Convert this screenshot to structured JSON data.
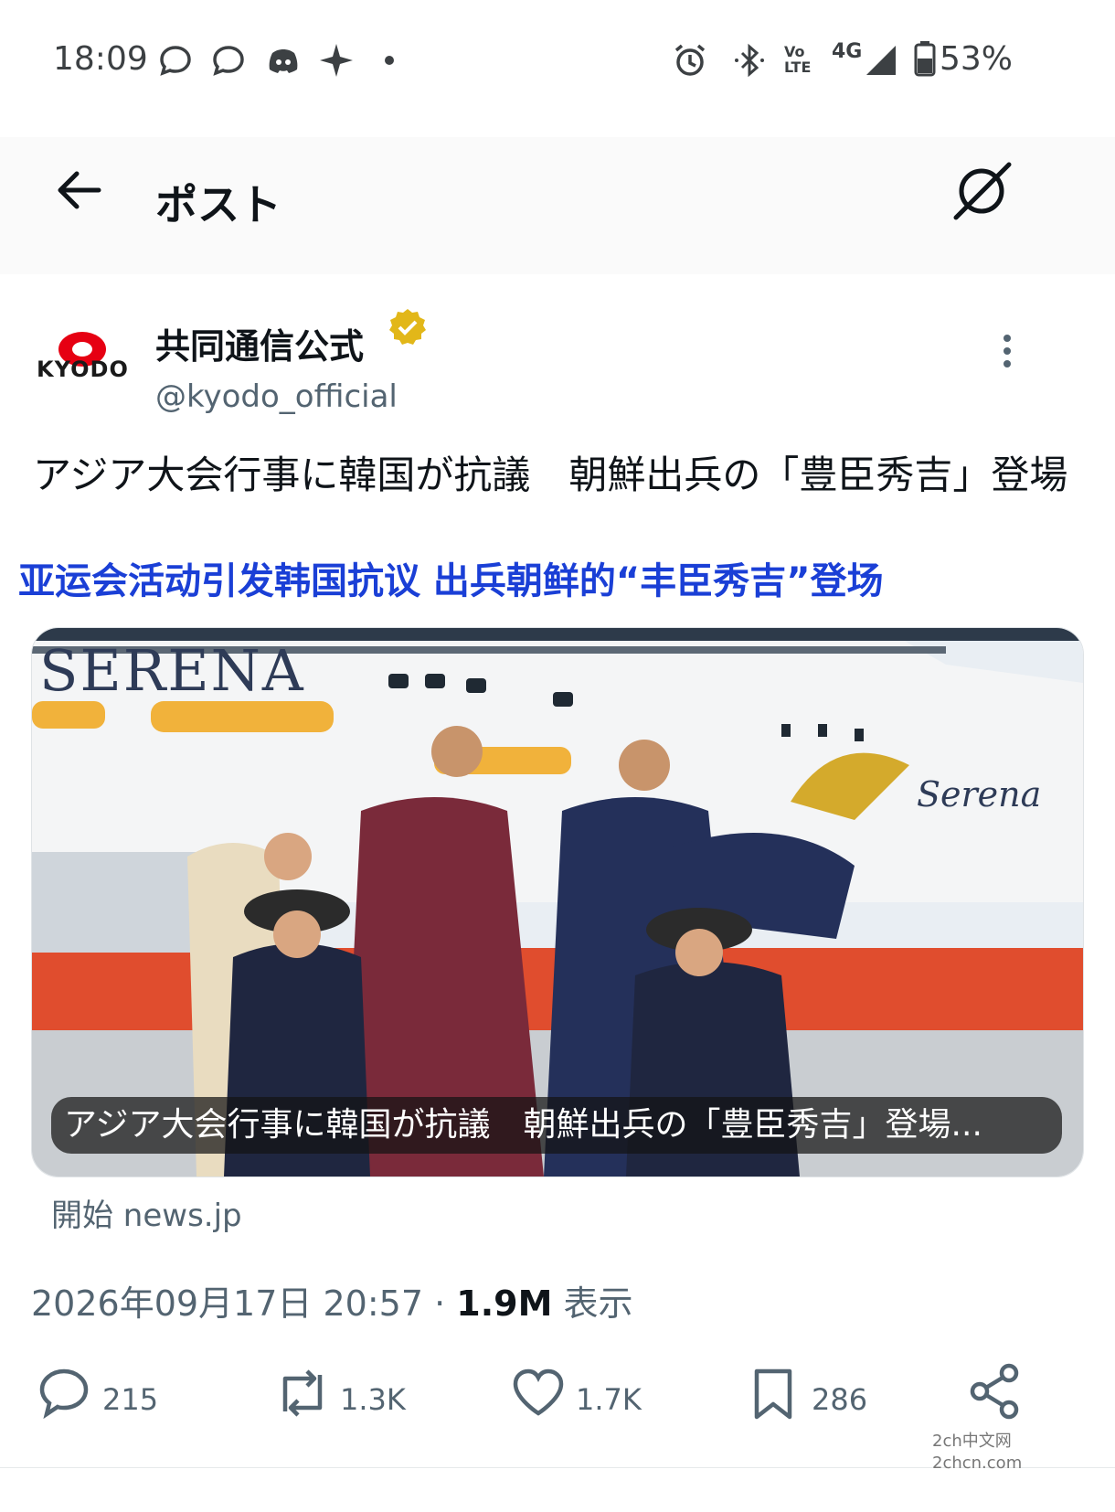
{
  "status_bar": {
    "time": "18:09",
    "battery": "53%",
    "network": "4G",
    "volte": "VoLTE",
    "icons": [
      "chat-bubble-icon",
      "chat-bubble-icon",
      "discord-icon",
      "sparkle-icon",
      "dot-icon",
      "alarm-icon",
      "bluetooth-icon",
      "volte-icon",
      "signal-icon",
      "battery-icon"
    ]
  },
  "header": {
    "title": "ポスト",
    "back_icon": "arrow-left-icon",
    "grok_icon": "slash-circle-icon"
  },
  "account": {
    "avatar_label": "KYODO",
    "name": "共同通信公式",
    "handle": "@kyodo_official",
    "verified_color": "#e2b719"
  },
  "tweet": {
    "text": "アジア大会行事に韓国が抗議　朝鮮出兵の「豊臣秀吉」登場",
    "overlay_translation": "亚运会活动引发韩国抗议 出兵朝鲜的“丰臣秀吉”登场"
  },
  "card": {
    "ship_name": "SERENA",
    "ship_logo": "Serena",
    "caption": "アジア大会行事に韓国が抗議　朝鮮出兵の「豊臣秀吉」登場...",
    "source": "開始 news.jp"
  },
  "meta": {
    "datetime": "2026年09月17日 20:57",
    "separator": "·",
    "views": "1.9M",
    "views_label": "表示"
  },
  "actions": {
    "replies": "215",
    "retweets": "1.3K",
    "likes": "1.7K",
    "bookmarks": "286"
  },
  "watermark": {
    "line1": "2ch中文网",
    "line2": "2chcn.com"
  },
  "colors": {
    "accent_blue": "#1a3fd6",
    "text_secondary": "#536471",
    "kyodo_red": "#e60012"
  }
}
